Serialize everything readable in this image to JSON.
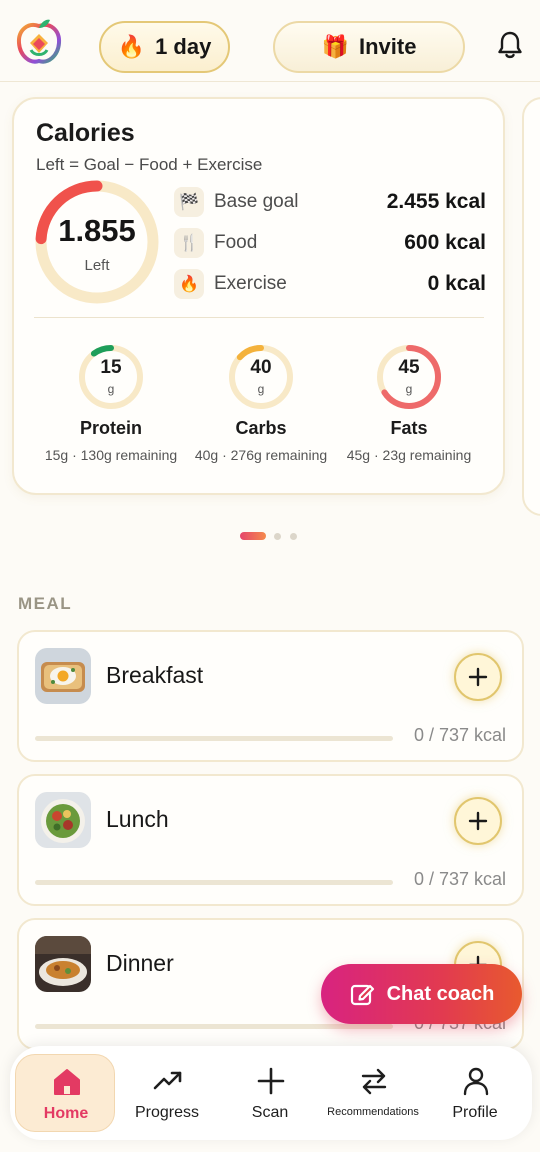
{
  "header": {
    "streak_emoji": "🔥",
    "streak_label": "1 day",
    "invite_emoji": "🎁",
    "invite_label": "Invite"
  },
  "calories": {
    "title": "Calories",
    "subtitle": "Left = Goal − Food + Exercise",
    "left_value": "1.855",
    "left_label": "Left",
    "progress_fraction": 0.24,
    "rows": [
      {
        "icon": "flag-icon",
        "emoji": "🏁",
        "label": "Base goal",
        "value": "2.455 kcal"
      },
      {
        "icon": "fork-knife-icon",
        "emoji": "🍴",
        "label": "Food",
        "value": "600 kcal"
      },
      {
        "icon": "flame-icon",
        "emoji": "🔥",
        "label": "Exercise",
        "value": "0 kcal"
      }
    ]
  },
  "macros": [
    {
      "name": "Protein",
      "value": "15",
      "unit": "g",
      "remaining": "15g · 130g remaining",
      "fraction": 0.1,
      "color": "#1e9e5a"
    },
    {
      "name": "Carbs",
      "value": "40",
      "unit": "g",
      "remaining": "40g · 276g remaining",
      "fraction": 0.13,
      "color": "#f4b23c"
    },
    {
      "name": "Fats",
      "value": "45",
      "unit": "g",
      "remaining": "45g · 23g remaining",
      "fraction": 0.66,
      "color": "#ee6a6a"
    }
  ],
  "carousel": {
    "page_count": 3,
    "active_page": 1
  },
  "meal_section": {
    "heading": "MEAL",
    "meals": [
      {
        "name": "Breakfast",
        "kcal": "0 / 737 kcal",
        "progress": 0
      },
      {
        "name": "Lunch",
        "kcal": "0 / 737 kcal",
        "progress": 0
      },
      {
        "name": "Dinner",
        "kcal": "0 / 737 kcal",
        "progress": 0
      }
    ]
  },
  "chat_coach": {
    "label": "Chat coach"
  },
  "nav": {
    "items": [
      {
        "label": "Home",
        "icon": "home-icon",
        "active": true
      },
      {
        "label": "Progress",
        "icon": "trending-up-icon",
        "active": false
      },
      {
        "label": "Scan",
        "icon": "plus-icon",
        "active": false
      },
      {
        "label": "Recommendations",
        "icon": "swap-arrows-icon",
        "active": false
      },
      {
        "label": "Profile",
        "icon": "person-icon",
        "active": false
      }
    ]
  },
  "colors": {
    "accent": "#e33a63",
    "gold": "#e1c66e",
    "ring_track": "#f8e9c7",
    "ring_progress": "#f0524c",
    "background": "#fdfbf6"
  }
}
